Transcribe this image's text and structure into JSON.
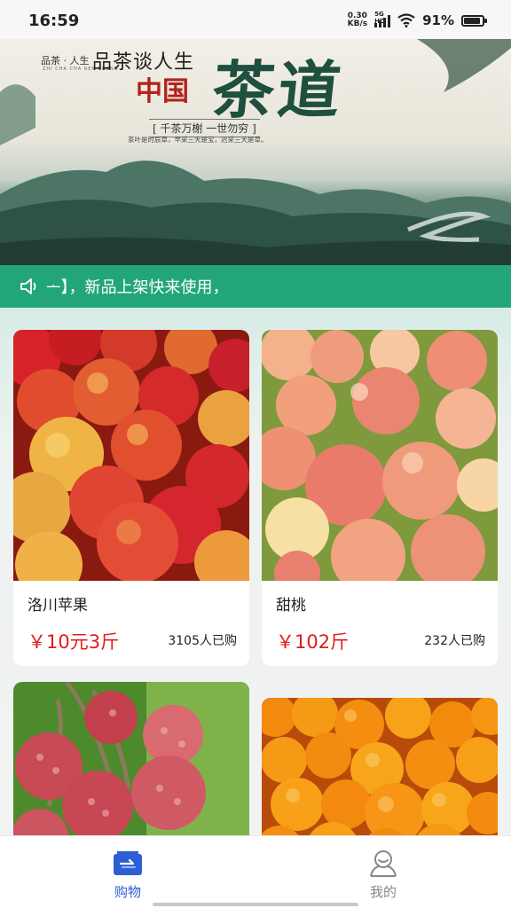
{
  "status_bar": {
    "time": "16:59",
    "net_speed_value": "0.30",
    "net_speed_unit": "KB/s",
    "signal_label": "5G HD",
    "battery_percent": "91%",
    "battery_level": 0.91
  },
  "banner": {
    "small_brand": "品茶 · 人生",
    "small_caption": "ZHI CHA CHA REN SHENG",
    "subtitle": "品茶谈人生",
    "china": "中国",
    "big_title": "茶道",
    "slogan": "[ 千茶万榭 一世勿穷 ]",
    "description": "茶叶是时辰草，早采三天是宝，迟采三天是草。"
  },
  "notice": {
    "icon": "speaker-icon",
    "text": "ᅩ】，新品上架快来使用，"
  },
  "products": [
    {
      "name": "洛川苹果",
      "price": "￥10元3斤",
      "sold": "3105人已购",
      "image": "apples"
    },
    {
      "name": "甜桃",
      "price": "￥102斤",
      "sold": "232人已购",
      "image": "peaches"
    },
    {
      "name": "",
      "price": "",
      "sold": "",
      "image": "lychees"
    },
    {
      "name": "",
      "price": "",
      "sold": "",
      "image": "oranges"
    }
  ],
  "tabbar": {
    "tabs": [
      {
        "label": "购物",
        "icon": "shopping-bag-icon",
        "active": true,
        "color": "#2c5fd3"
      },
      {
        "label": "我的",
        "icon": "user-icon",
        "active": false,
        "color": "#888888"
      }
    ]
  },
  "colors": {
    "accent_green": "#23a677",
    "price_red": "#e21b1b",
    "tab_active": "#2c5fd3"
  }
}
